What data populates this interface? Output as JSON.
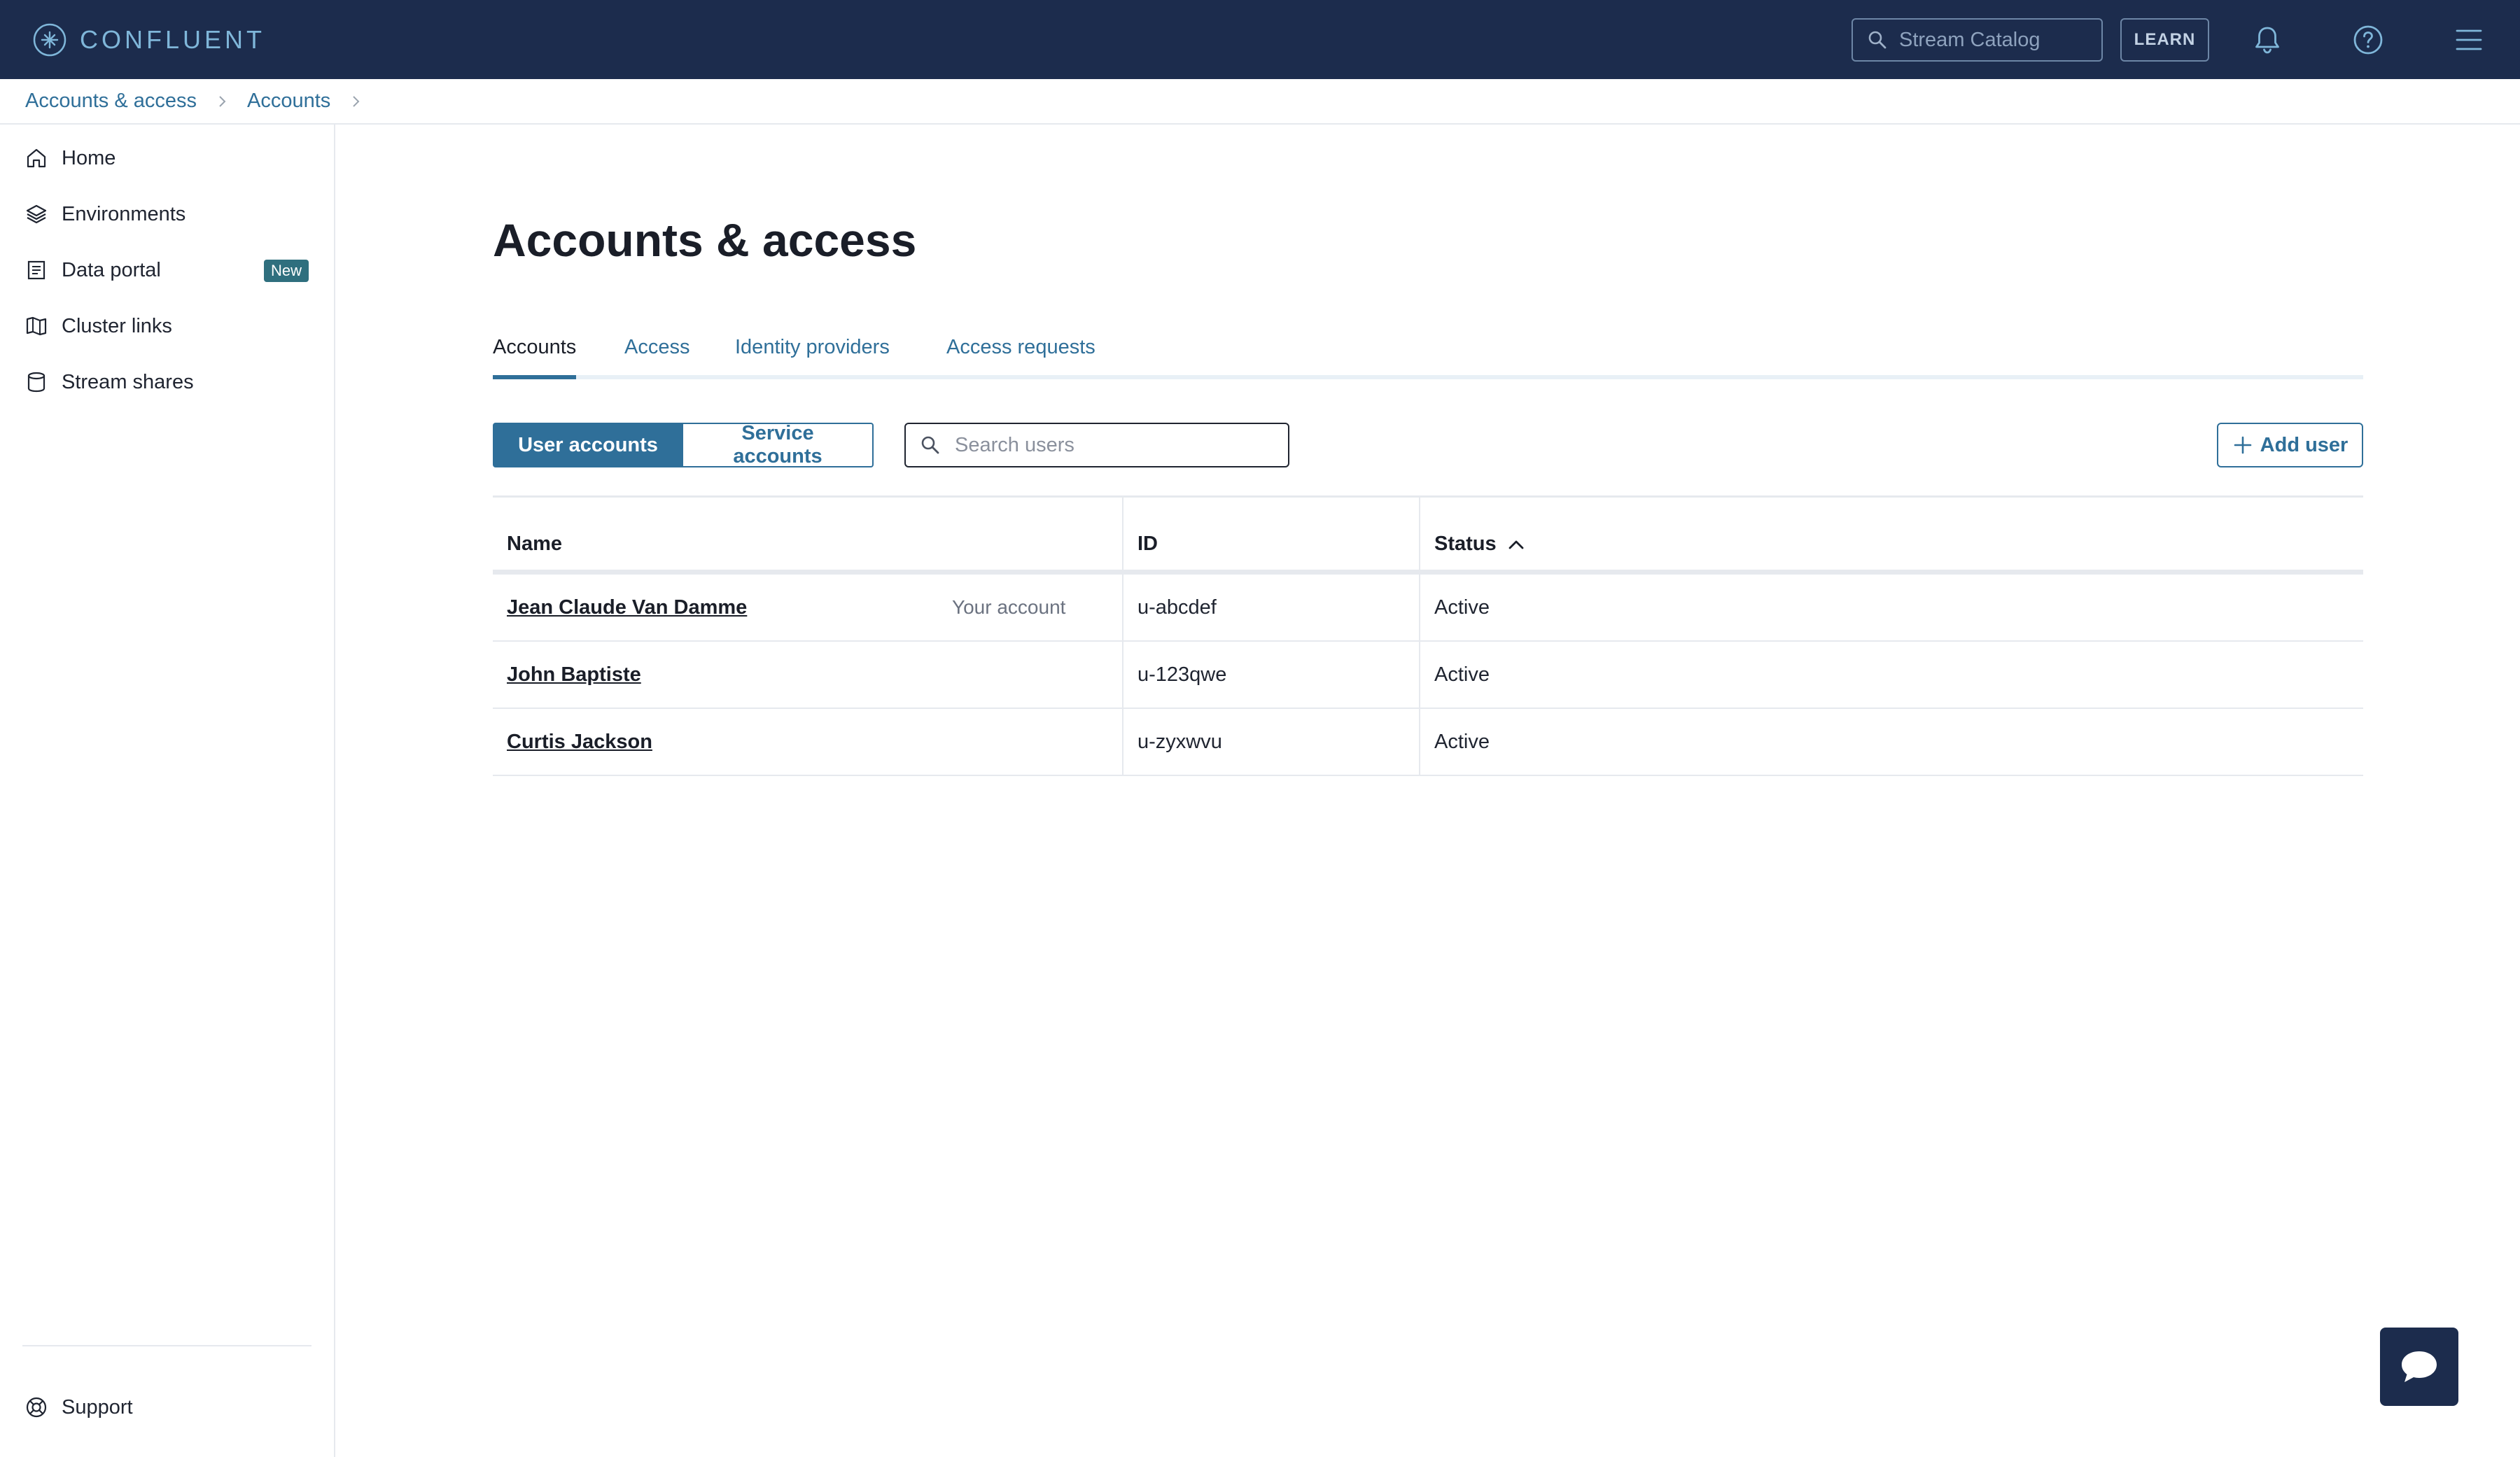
{
  "app": {
    "brand_name": "CONFLUENT",
    "accent_color": "#2f6f99",
    "header_color": "#1c2c4d"
  },
  "header": {
    "search_placeholder": "Stream Catalog",
    "learn_label": "LEARN",
    "icons": [
      "bell-icon",
      "help-icon",
      "menu-icon"
    ]
  },
  "breadcrumb": {
    "items": [
      "Accounts & access",
      "Accounts"
    ]
  },
  "sidebar": {
    "items": [
      {
        "label": "Home",
        "icon": "home-icon"
      },
      {
        "label": "Environments",
        "icon": "layers-icon"
      },
      {
        "label": "Data portal",
        "icon": "document-icon",
        "badge": "New"
      },
      {
        "label": "Cluster links",
        "icon": "map-icon"
      },
      {
        "label": "Stream shares",
        "icon": "database-icon"
      }
    ],
    "footer": {
      "label": "Support",
      "icon": "lifebuoy-icon"
    }
  },
  "main": {
    "title": "Accounts & access",
    "tabs": [
      {
        "label": "Accounts",
        "active": true
      },
      {
        "label": "Access",
        "active": false
      },
      {
        "label": "Identity providers",
        "active": false
      },
      {
        "label": "Access requests",
        "active": false
      }
    ],
    "segments": {
      "selected": "User accounts",
      "other": "Service accounts"
    },
    "search_placeholder": "Search users",
    "add_user_label": "Add user",
    "table": {
      "columns": [
        "Name",
        "ID",
        "Status"
      ],
      "sort_column": "Status",
      "sort_direction": "ascending",
      "rows": [
        {
          "name": "Jean Claude Van Damme",
          "note": "Your account",
          "id": "u-abcdef",
          "status": "Active"
        },
        {
          "name": "John Baptiste",
          "note": "",
          "id": "u-123qwe",
          "status": "Active"
        },
        {
          "name": "Curtis Jackson",
          "note": "",
          "id": "u-zyxwvu",
          "status": "Active"
        }
      ]
    }
  }
}
